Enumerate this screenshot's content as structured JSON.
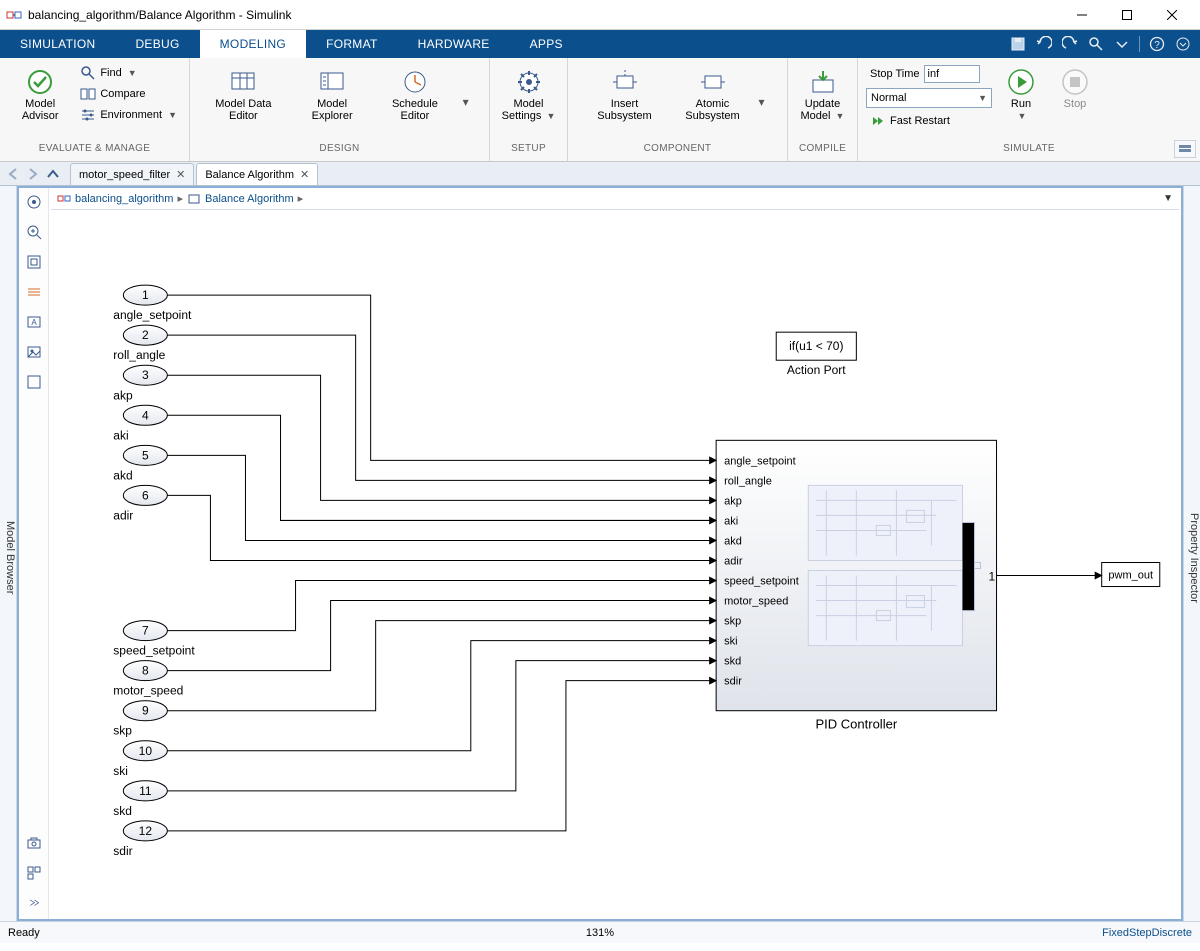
{
  "window": {
    "title": "balancing_algorithm/Balance Algorithm - Simulink"
  },
  "menutabs": {
    "simulation": "SIMULATION",
    "debug": "DEBUG",
    "modeling": "MODELING",
    "format": "FORMAT",
    "hardware": "HARDWARE",
    "apps": "APPS"
  },
  "toolstrip": {
    "evaluate": {
      "model_advisor": "Model\nAdvisor",
      "find": "Find",
      "compare": "Compare",
      "environment": "Environment",
      "foot": "EVALUATE & MANAGE"
    },
    "design": {
      "model_data_editor": "Model Data\nEditor",
      "model_explorer": "Model\nExplorer",
      "schedule_editor": "Schedule\nEditor",
      "foot": "DESIGN"
    },
    "setup": {
      "model_settings": "Model\nSettings",
      "foot": "SETUP"
    },
    "component": {
      "insert_subsystem": "Insert\nSubsystem",
      "atomic_subsystem": "Atomic\nSubsystem",
      "foot": "COMPONENT"
    },
    "compile": {
      "update_model": "Update\nModel",
      "foot": "COMPILE"
    },
    "simulate": {
      "stop_time_label": "Stop Time",
      "stop_time_value": "inf",
      "mode": "Normal",
      "fast_restart": "Fast Restart",
      "run": "Run",
      "stop": "Stop",
      "foot": "SIMULATE"
    }
  },
  "doctabs": {
    "tab1": "motor_speed_filter",
    "tab2": "Balance Algorithm"
  },
  "breadcrumb": {
    "root": "balancing_algorithm",
    "sub": "Balance Algorithm"
  },
  "rails": {
    "left": "Model Browser",
    "right": "Property Inspector"
  },
  "diagram": {
    "inports": [
      {
        "n": "1",
        "lbl": "angle_setpoint"
      },
      {
        "n": "2",
        "lbl": "roll_angle"
      },
      {
        "n": "3",
        "lbl": "akp"
      },
      {
        "n": "4",
        "lbl": "aki"
      },
      {
        "n": "5",
        "lbl": "akd"
      },
      {
        "n": "6",
        "lbl": "adir"
      },
      {
        "n": "7",
        "lbl": "speed_setpoint"
      },
      {
        "n": "8",
        "lbl": "motor_speed"
      },
      {
        "n": "9",
        "lbl": "skp"
      },
      {
        "n": "10",
        "lbl": "ski"
      },
      {
        "n": "11",
        "lbl": "skd"
      },
      {
        "n": "12",
        "lbl": "sdir"
      }
    ],
    "action_port": {
      "cond": "if(u1 < 70)",
      "lbl": "Action Port"
    },
    "pid_block": {
      "title": "PID Controller",
      "ports": [
        "angle_setpoint",
        "roll_angle",
        "akp",
        "aki",
        "akd",
        "adir",
        "speed_setpoint",
        "motor_speed",
        "skp",
        "ski",
        "skd",
        "sdir"
      ],
      "outnum": "1"
    },
    "outport": {
      "lbl": "pwm_out"
    }
  },
  "statusbar": {
    "ready": "Ready",
    "zoom": "131%",
    "solver": "FixedStepDiscrete"
  }
}
